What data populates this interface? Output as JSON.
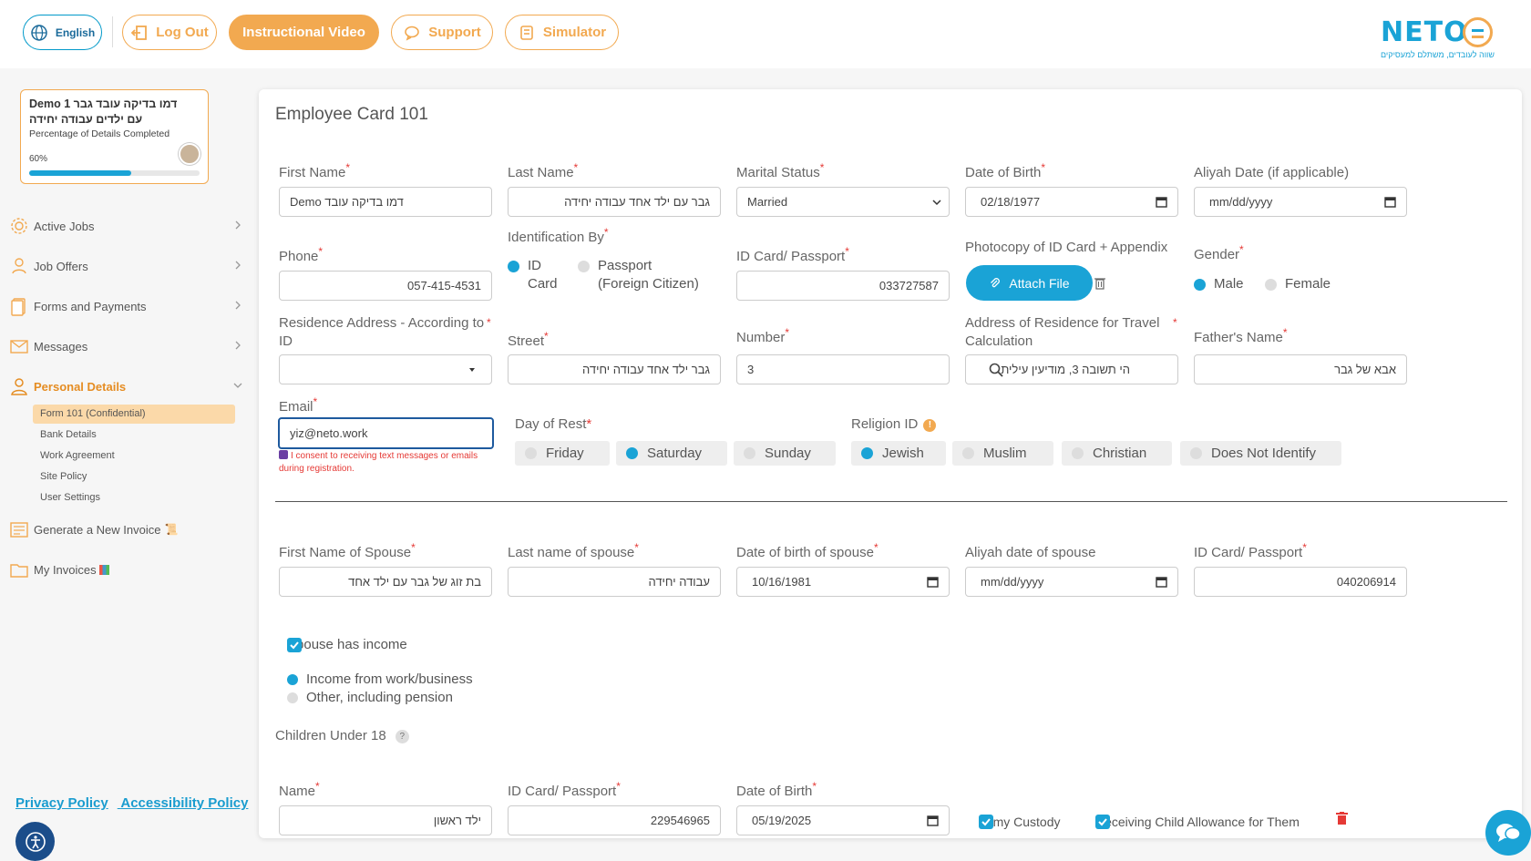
{
  "header": {
    "language_label": "English",
    "logout_label": "Log Out",
    "video_label": "Instructional Video",
    "support_label": "Support",
    "simulator_label": "Simulator",
    "logo_text": "NETO",
    "logo_tagline": "שווה לעובדים, משתלם למעסיקים"
  },
  "profile": {
    "name": "Demo 1 דמו בדיקה עובד גבר עם ילדים עבודה יחידה",
    "details_label": "Percentage of Details Completed",
    "percent_text": "60%",
    "percent_value": 0.6
  },
  "nav": {
    "items": [
      {
        "label": "Active Jobs"
      },
      {
        "label": "Job Offers"
      },
      {
        "label": "Forms and Payments"
      },
      {
        "label": "Messages"
      },
      {
        "label": "Personal Details"
      }
    ],
    "sub_items": [
      {
        "label": "Form 101 (Confidential)"
      },
      {
        "label": "Bank Details"
      },
      {
        "label": "Work Agreement"
      },
      {
        "label": "Site Policy"
      },
      {
        "label": "User Settings"
      }
    ],
    "invoice_label": "Generate a New Invoice",
    "my_invoices_label": "My Invoices"
  },
  "footer": {
    "privacy": "Privacy Policy",
    "accessibility": "Accessibility Policy"
  },
  "form": {
    "title": "Employee Card 101",
    "first_name": {
      "label": "First Name",
      "value": "Demo דמו בדיקה עובד"
    },
    "last_name": {
      "label": "Last Name",
      "value": "גבר עם ילד אחד עבודה יחידה"
    },
    "marital": {
      "label": "Marital Status",
      "value": "Married"
    },
    "dob": {
      "label": "Date of Birth",
      "value": "02/18/1977"
    },
    "aliyah": {
      "label": "Aliyah Date (if applicable)",
      "value": "mm/dd/yyyy"
    },
    "phone": {
      "label": "Phone",
      "value": "057-415-4531"
    },
    "ident_by": {
      "label": "Identification By",
      "opt1": "ID Card",
      "opt2": "Passport (Foreign Citizen)"
    },
    "id_card": {
      "label": "ID Card/ Passport",
      "value": "033727587"
    },
    "photocopy": {
      "label": "Photocopy of ID Card + Appendix",
      "button": "Attach File"
    },
    "gender": {
      "label": "Gender",
      "male": "Male",
      "female": "Female"
    },
    "residence": {
      "label": "Residence Address - According to ID",
      "value": ""
    },
    "street": {
      "label": "Street",
      "value": "גבר ילד אחד עבודה יחידה"
    },
    "number": {
      "label": "Number",
      "value": "3"
    },
    "travel_address": {
      "label": "Address of Residence for Travel Calculation",
      "value": "הי תשובה 3, מודיעין עילית"
    },
    "father": {
      "label": "Father's Name",
      "value": "אבא של גבר"
    },
    "email": {
      "label": "Email",
      "value": "yiz@neto.work"
    },
    "consent": "I consent to receiving text messages or emails during registration.",
    "rest": {
      "label": "Day of Rest",
      "options": [
        "Friday",
        "Saturday",
        "Sunday"
      ]
    },
    "religion": {
      "label": "Religion ID",
      "options": [
        "Jewish",
        "Muslim",
        "Christian",
        "Does Not Identify"
      ]
    },
    "spouse_first": {
      "label": "First Name of Spouse",
      "value": "בת זוג של גבר עם ילד אחד"
    },
    "spouse_last": {
      "label": "Last name of spouse",
      "value": "עבודה יחידה"
    },
    "spouse_dob": {
      "label": "Date of birth of spouse",
      "value": "10/16/1981"
    },
    "spouse_aliyah": {
      "label": "Aliyah date of spouse",
      "value": "mm/dd/yyyy"
    },
    "spouse_id": {
      "label": "ID Card/ Passport",
      "value": "040206914"
    },
    "spouse_income": "Spouse has income",
    "income_work": "Income from work/business",
    "income_other": "Other, including pension",
    "children_label": "Children Under 18",
    "child_name": {
      "label": "Name",
      "value": "ילד ראשון"
    },
    "child_id": {
      "label": "ID Card/ Passport",
      "value": "229546965"
    },
    "child_dob": {
      "label": "Date of Birth",
      "value": "05/19/2025"
    },
    "custody": "In my Custody",
    "allowance": "Receiving Child Allowance for Them"
  }
}
